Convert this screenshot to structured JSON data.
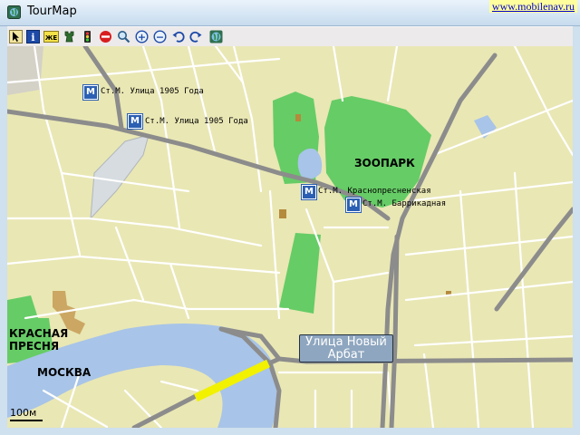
{
  "window": {
    "title": "TourMap",
    "watermark": "www.mobilenav.ru",
    "accent": "#c6dbee"
  },
  "toolbar": {
    "buttons": [
      {
        "name": "pointer-tool",
        "icon": "cursor-arrow-icon"
      },
      {
        "name": "info-tool",
        "icon": "info-icon",
        "glyph": "i"
      },
      {
        "name": "route-tool",
        "icon": "route-label-icon",
        "glyph": "ЖЕ"
      },
      {
        "name": "tower-tool",
        "icon": "tower-icon"
      },
      {
        "name": "traffic-tool",
        "icon": "traffic-light-icon"
      },
      {
        "name": "stop-tool",
        "icon": "no-entry-icon"
      },
      {
        "name": "search-tool",
        "icon": "search-icon"
      },
      {
        "name": "zoom-in-tool",
        "icon": "zoom-in-icon",
        "glyph": "+"
      },
      {
        "name": "zoom-out-tool",
        "icon": "zoom-out-icon",
        "glyph": "−"
      },
      {
        "name": "undo-tool",
        "icon": "undo-icon"
      },
      {
        "name": "redo-tool",
        "icon": "redo-icon"
      },
      {
        "name": "globe-tool",
        "icon": "globe-icon"
      }
    ]
  },
  "map": {
    "metro_stations": [
      {
        "label": "Ст.М. Улица 1905 Года"
      },
      {
        "label": "Ст.М. Улица 1905 Года"
      },
      {
        "label": "Ст.М. Краснопресненская"
      },
      {
        "label": "Ст.М. Баррикадная"
      }
    ],
    "metro_glyph": "M",
    "zoo_label": "ЗООПАРК",
    "district_label_line1": "КРАСНАЯ",
    "district_label_line2": "ПРЕСНЯ",
    "river_label": "МОСКВА",
    "street_tooltip_line1": "Улица  Новый",
    "street_tooltip_line2": "Арбат",
    "scale_label": "100м",
    "colors": {
      "land": "#e9e7b4",
      "park": "#66cc66",
      "water": "#a8c4e8",
      "road": "#ffffff",
      "major_road": "#8c8c8c",
      "highlight_road": "#f0f000"
    }
  }
}
